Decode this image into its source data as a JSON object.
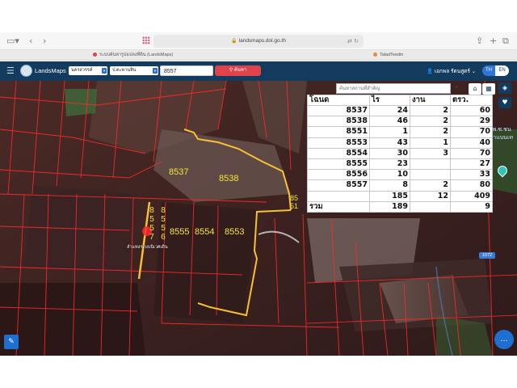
{
  "browser": {
    "url": "landsmaps.dol.go.th",
    "tabs": [
      {
        "label": "ระบบค้นหารูปแปลงที่ดิน (LandsMaps)",
        "dot_color": "#e0424b"
      },
      {
        "label": "TaladTeedin",
        "dot_color": "#f08a24"
      }
    ],
    "icons": [
      "sidebar-icon",
      "back-icon",
      "forward-icon",
      "share-icon",
      "new-tab-icon",
      "tabs-overview-icon"
    ]
  },
  "header": {
    "app_name": "LandsMaps",
    "province": "นครสวรรค์",
    "district": "ป.ตะพานหิน",
    "search_value": "8557",
    "search_button": "ค้นหา",
    "user_name": "เอกพล รัตนสูตร์",
    "lang_th": "TH",
    "lang_en": "EN"
  },
  "map": {
    "place_search_placeholder": "ค้นหาสถานที่สำคัญ",
    "parcels": [
      "8537",
      "8538",
      "8555",
      "8554",
      "8553"
    ],
    "vertical_numbers": {
      "col1": [
        "8",
        "5",
        "5",
        "7"
      ],
      "col2": [
        "8",
        "5",
        "5",
        "6"
      ],
      "edge": [
        "85",
        "51"
      ]
    },
    "road_label": "ลำแทงระบบนิเวศเดิน",
    "right_labels": [
      "รพ.ซ.ชน",
      "ลำแบนเท"
    ],
    "road_number": "1072",
    "colors": {
      "parcel_border": "#ff2a2a",
      "highlight": "#f7c033",
      "label": "#f2e53a"
    }
  },
  "table": {
    "headers": [
      "โฉนด",
      "ไร",
      "งาน",
      "ตรว."
    ],
    "rows": [
      [
        "8537",
        "24",
        "2",
        "60"
      ],
      [
        "8538",
        "46",
        "2",
        "29"
      ],
      [
        "8551",
        "1",
        "2",
        "70"
      ],
      [
        "8553",
        "43",
        "1",
        "40"
      ],
      [
        "8554",
        "30",
        "3",
        "70"
      ],
      [
        "8555",
        "23",
        "",
        "27"
      ],
      [
        "8556",
        "10",
        "",
        "33"
      ],
      [
        "8557",
        "8",
        "2",
        "80"
      ],
      [
        "",
        "185",
        "12",
        "409"
      ]
    ],
    "total": [
      "รวม",
      "189",
      "",
      "9"
    ]
  }
}
